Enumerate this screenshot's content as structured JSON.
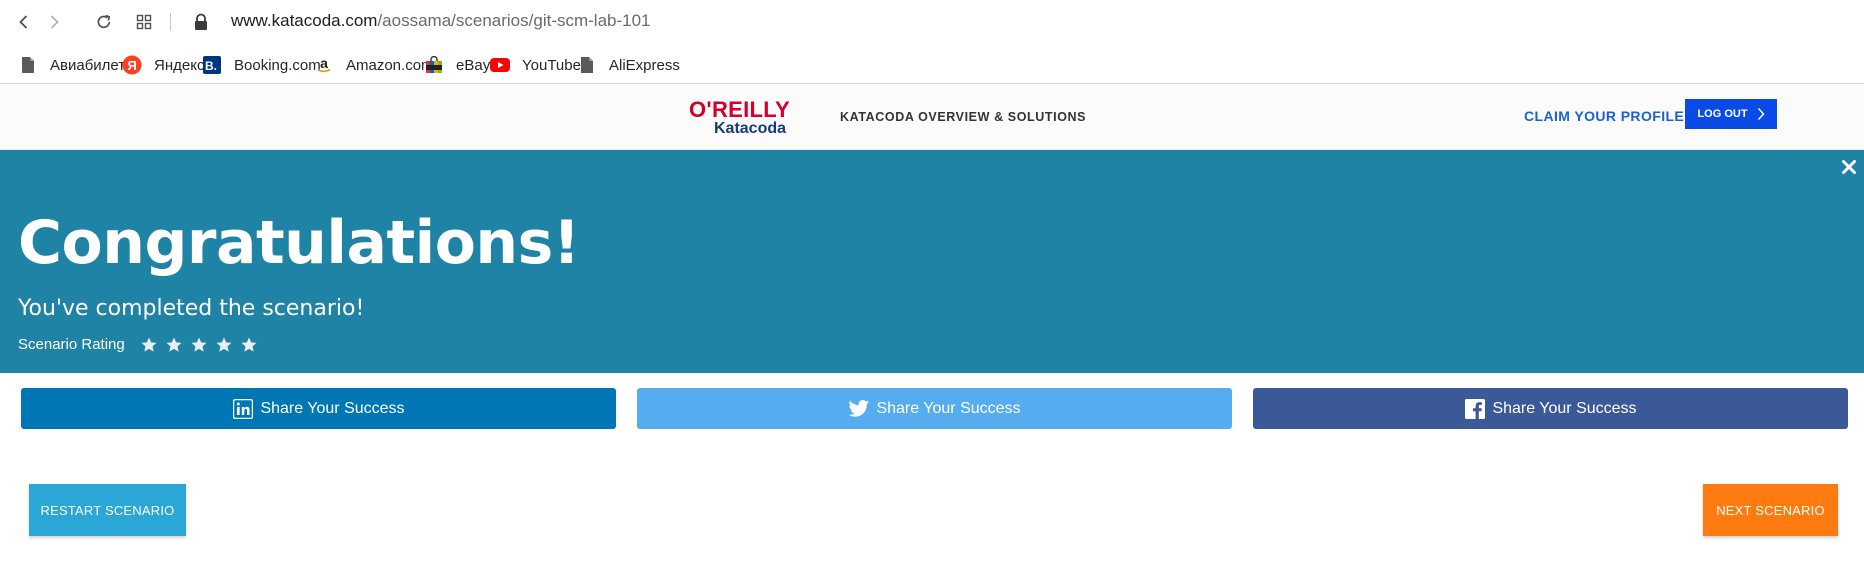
{
  "browser": {
    "url_host": "www.katacoda.com",
    "url_path": "/aossama/scenarios/git-scm-lab-101",
    "bookmarks": [
      {
        "label": "Авиабилеты",
        "icon": "page-icon"
      },
      {
        "label": "Яндекс",
        "icon": "yandex-icon"
      },
      {
        "label": "Booking.com",
        "icon": "booking-icon"
      },
      {
        "label": "Amazon.com",
        "icon": "amazon-icon"
      },
      {
        "label": "eBay",
        "icon": "ebay-icon"
      },
      {
        "label": "YouTube",
        "icon": "youtube-icon"
      },
      {
        "label": "AliExpress",
        "icon": "page-icon"
      }
    ]
  },
  "header": {
    "logo_top": "O'REILLY",
    "logo_bottom": "Katacoda",
    "nav_link": "KATACODA OVERVIEW & SOLUTIONS",
    "claim_profile": "CLAIM YOUR PROFILE",
    "logout": "LOG OUT"
  },
  "banner": {
    "title": "Congratulations!",
    "subtitle": "You've completed the scenario!",
    "rating_label": "Scenario Rating",
    "star_count": 5,
    "background": "#1f83a5"
  },
  "share": {
    "linkedin": {
      "label": "Share Your Success",
      "color": "#0077b5",
      "icon": "linkedin-icon"
    },
    "twitter": {
      "label": "Share Your Success",
      "color": "#55acee",
      "icon": "twitter-icon"
    },
    "facebook": {
      "label": "Share Your Success",
      "color": "#3b5998",
      "icon": "facebook-icon"
    }
  },
  "actions": {
    "restart": "RESTART SCENARIO",
    "next": "NEXT SCENARIO"
  },
  "colors": {
    "accent_blue": "#0a4be8",
    "restart_bg": "#2aa7d7",
    "next_bg": "#ff7a0f"
  }
}
